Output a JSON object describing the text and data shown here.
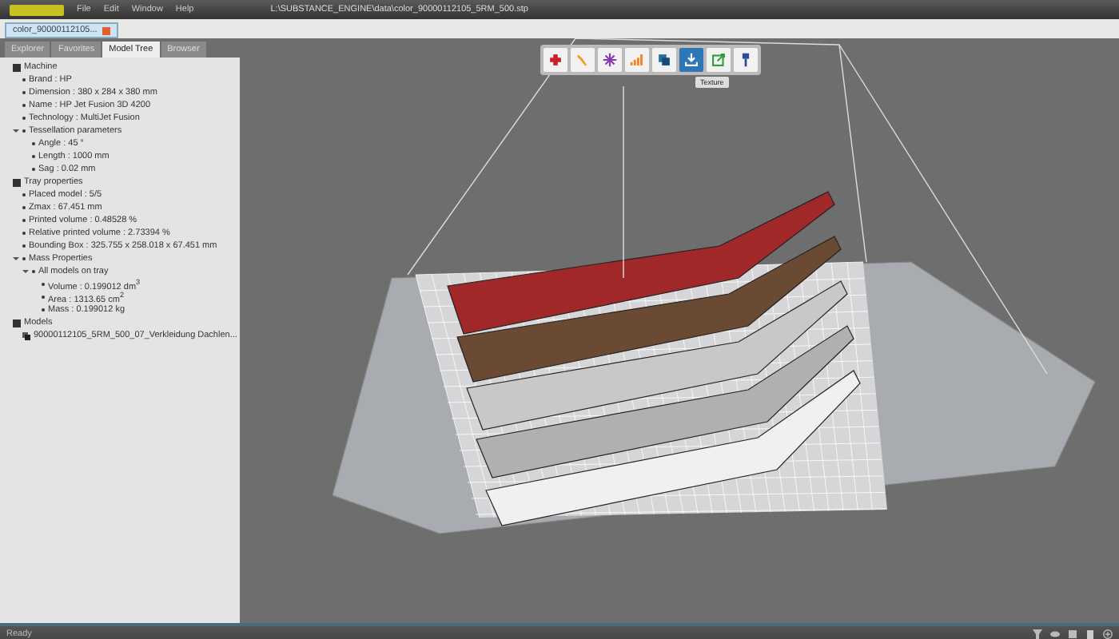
{
  "window": {
    "title": "L:\\SUBSTANCE_ENGINE\\data\\color_90000112105_5RM_500.stp"
  },
  "menu": [
    "File",
    "Edit",
    "Window",
    "Help"
  ],
  "document_tab": {
    "label": "color_90000112105...",
    "selected": true
  },
  "panel_tabs": [
    {
      "label": "Explorer",
      "selected": false
    },
    {
      "label": "Favorites",
      "selected": false
    },
    {
      "label": "Model Tree",
      "selected": true
    },
    {
      "label": "Browser",
      "selected": false
    }
  ],
  "tree": [
    {
      "kind": "section",
      "label": "Machine",
      "children": [
        {
          "kind": "leaf",
          "label": "Brand : HP"
        },
        {
          "kind": "leaf",
          "label": "Dimension : 380 x 284 x 380 mm"
        },
        {
          "kind": "leaf",
          "label": "Name : HP Jet Fusion 3D 4200"
        },
        {
          "kind": "leaf",
          "label": "Technology : MultiJet Fusion"
        },
        {
          "kind": "leaf",
          "label": "Tessellation parameters",
          "expanded": true,
          "children": [
            {
              "kind": "leaf",
              "label": "Angle : 45 °"
            },
            {
              "kind": "leaf",
              "label": "Length : 1000 mm"
            },
            {
              "kind": "leaf",
              "label": "Sag : 0.02 mm"
            }
          ]
        }
      ]
    },
    {
      "kind": "section",
      "label": "Tray properties",
      "children": [
        {
          "kind": "leaf",
          "label": "Placed model : 5/5"
        },
        {
          "kind": "leaf",
          "label": "Zmax : 67.451 mm"
        },
        {
          "kind": "leaf",
          "label": "Printed volume : 0.48528  %"
        },
        {
          "kind": "leaf",
          "label": "Relative printed volume : 2.73394  %"
        },
        {
          "kind": "leaf",
          "label": "Bounding Box : 325.755 x 258.018 x 67.451 mm"
        },
        {
          "kind": "leaf",
          "label": "Mass Properties",
          "expanded": true,
          "children": [
            {
              "kind": "leaf",
              "label": "All models on tray",
              "expanded": true,
              "children": [
                {
                  "kind": "leaf",
                  "label": "Volume : 0.199012 dm$^{3}$"
                },
                {
                  "kind": "leaf",
                  "label": "Area : 1313.65 cm$^{2}$"
                },
                {
                  "kind": "leaf",
                  "label": "Mass : 0.199012 kg"
                }
              ]
            }
          ]
        }
      ]
    },
    {
      "kind": "section",
      "label": "Models",
      "children": [
        {
          "kind": "model",
          "label": "90000112105_5RM_500_07_Verkleidung Dachlen..."
        }
      ]
    }
  ],
  "toolbar": [
    {
      "selected": false
    },
    {
      "selected": false
    },
    {
      "selected": false
    },
    {
      "selected": false
    },
    {
      "selected": false
    },
    {
      "selected": true
    },
    {
      "selected": false
    },
    {
      "selected": false
    }
  ],
  "tooltip": "Texture",
  "status_bar": {
    "text": "Ready"
  }
}
